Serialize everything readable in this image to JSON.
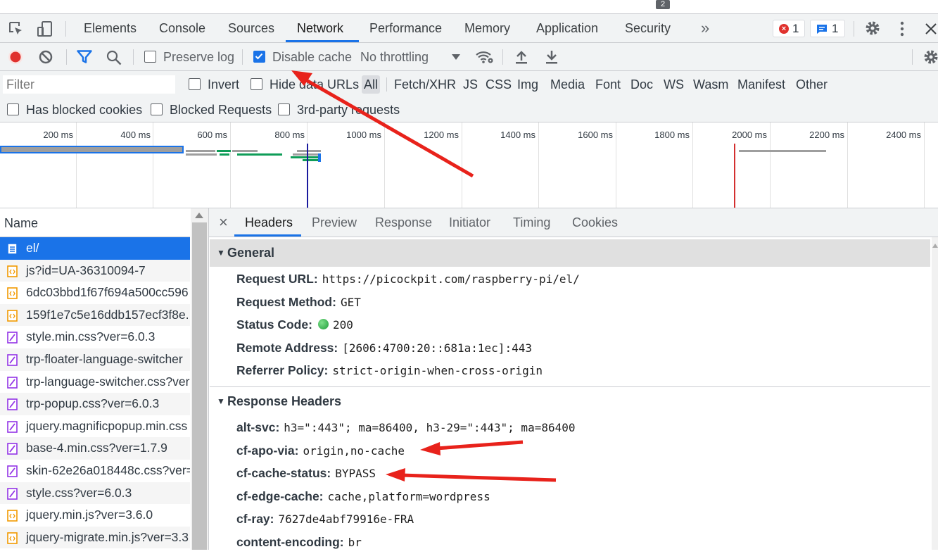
{
  "browser": {
    "badge_count": "2"
  },
  "tabs": {
    "items": [
      "Elements",
      "Console",
      "Sources",
      "Network",
      "Performance",
      "Memory",
      "Application",
      "Security"
    ],
    "active": "Network",
    "overflow": "»",
    "error_count": "1",
    "message_count": "1"
  },
  "toolbar": {
    "preserve_log": "Preserve log",
    "preserve_log_checked": false,
    "disable_cache": "Disable cache",
    "disable_cache_checked": true,
    "throttling": "No throttling"
  },
  "filterbar": {
    "filter_placeholder": "Filter",
    "invert": "Invert",
    "hide_data_urls": "Hide data URLs",
    "types": [
      "All",
      "Fetch/XHR",
      "JS",
      "CSS",
      "Img",
      "Media",
      "Font",
      "Doc",
      "WS",
      "Wasm",
      "Manifest",
      "Other"
    ],
    "active_type": "All",
    "has_blocked_cookies": "Has blocked cookies",
    "blocked_requests": "Blocked Requests",
    "third_party": "3rd-party requests"
  },
  "overview": {
    "ticks": [
      "200 ms",
      "400 ms",
      "600 ms",
      "800 ms",
      "1000 ms",
      "1200 ms",
      "1400 ms",
      "1600 ms",
      "1800 ms",
      "2000 ms",
      "2200 ms",
      "2400 ms"
    ]
  },
  "requests": {
    "header": "Name",
    "rows": [
      {
        "name": "el/",
        "type": "doc"
      },
      {
        "name": "js?id=UA-36310094-7",
        "type": "script"
      },
      {
        "name": "6dc03bbd1f67f694a500cc596",
        "type": "script"
      },
      {
        "name": "159f1e7c5e16ddb157ecf3f8e.",
        "type": "script"
      },
      {
        "name": "style.min.css?ver=6.0.3",
        "type": "css"
      },
      {
        "name": "trp-floater-language-switcher",
        "type": "css"
      },
      {
        "name": "trp-language-switcher.css?ver",
        "type": "css"
      },
      {
        "name": "trp-popup.css?ver=6.0.3",
        "type": "css"
      },
      {
        "name": "jquery.magnificpopup.min.css",
        "type": "css"
      },
      {
        "name": "base-4.min.css?ver=1.7.9",
        "type": "css"
      },
      {
        "name": "skin-62e26a018448c.css?ver=",
        "type": "css"
      },
      {
        "name": "style.css?ver=6.0.3",
        "type": "css"
      },
      {
        "name": "jquery.min.js?ver=3.6.0",
        "type": "script"
      },
      {
        "name": "jquery-migrate.min.js?ver=3.3",
        "type": "script"
      }
    ]
  },
  "details": {
    "close": "×",
    "tabs": [
      "Headers",
      "Preview",
      "Response",
      "Initiator",
      "Timing",
      "Cookies"
    ],
    "active_tab": "Headers",
    "general": {
      "title": "General",
      "rows": [
        {
          "key": "Request URL:",
          "value": "https://picockpit.com/raspberry-pi/el/"
        },
        {
          "key": "Request Method:",
          "value": "GET"
        },
        {
          "key": "Status Code:",
          "value": "200"
        },
        {
          "key": "Remote Address:",
          "value": "[2606:4700:20::681a:1ec]:443"
        },
        {
          "key": "Referrer Policy:",
          "value": "strict-origin-when-cross-origin"
        }
      ]
    },
    "response_headers": {
      "title": "Response Headers",
      "rows": [
        {
          "key": "alt-svc:",
          "value": "h3=\":443\"; ma=86400, h3-29=\":443\"; ma=86400"
        },
        {
          "key": "cf-apo-via:",
          "value": "origin,no-cache"
        },
        {
          "key": "cf-cache-status:",
          "value": "BYPASS"
        },
        {
          "key": "cf-edge-cache:",
          "value": "cache,platform=wordpress"
        },
        {
          "key": "cf-ray:",
          "value": "7627de4abf79916e-FRA"
        },
        {
          "key": "content-encoding:",
          "value": "br"
        }
      ]
    }
  },
  "colors": {
    "accent": "#1a73e8",
    "record": "#e0312d",
    "annotation_arrow": "#e8221b",
    "status_ok": "#34a853"
  }
}
